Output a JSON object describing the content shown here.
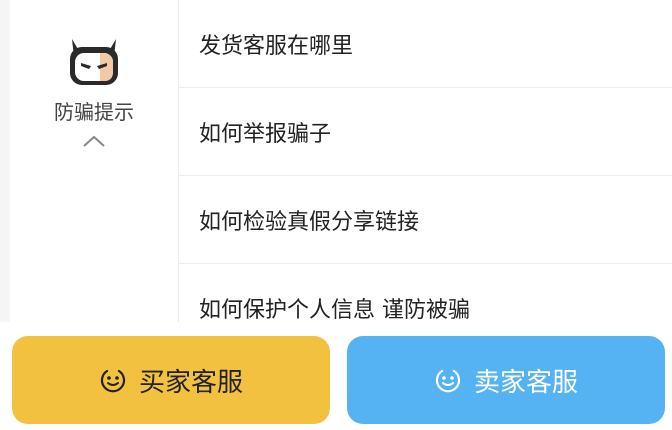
{
  "sidebar": {
    "category_label": "防骗提示",
    "mascot_icon": "devil-mascot-icon",
    "collapse_icon": "chevron-up-icon"
  },
  "faq": {
    "items": [
      "发货客服在哪里",
      "如何举报骗子",
      "如何检验真假分享链接",
      "如何保护个人信息 谨防被骗"
    ]
  },
  "actions": {
    "buyer_label": "买家客服",
    "seller_label": "卖家客服",
    "buyer_color": "#f2c140",
    "seller_color": "#56b3f3",
    "button_icon": "smile-face-icon"
  }
}
